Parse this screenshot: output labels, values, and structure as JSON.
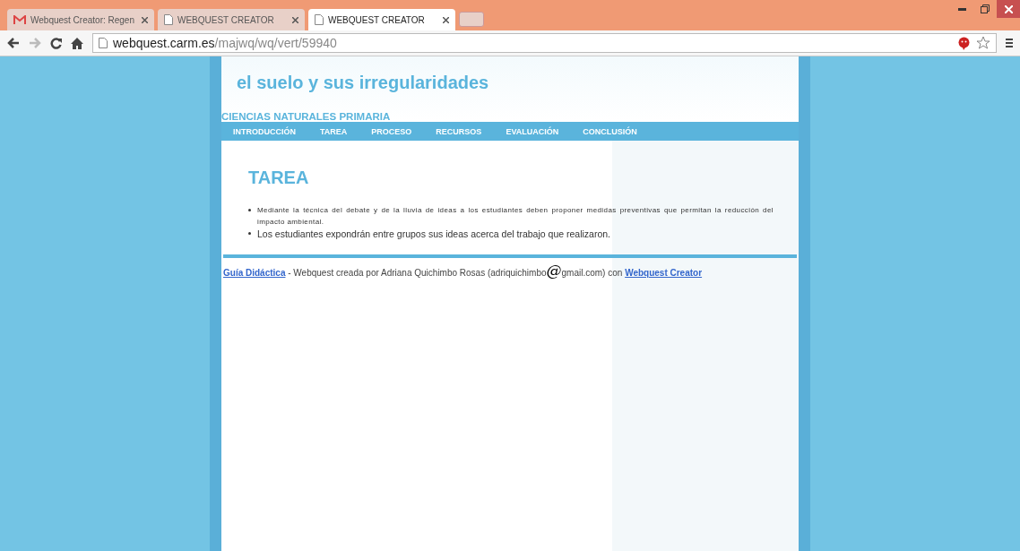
{
  "browser": {
    "tabs": [
      {
        "title": "Webquest Creator: Regen",
        "selected": false
      },
      {
        "title": "WEBQUEST CREATOR",
        "selected": false
      },
      {
        "title": "WEBQUEST CREATOR",
        "selected": true
      }
    ],
    "url_host": "webquest.carm.es",
    "url_path": "/majwq/wq/vert/59940"
  },
  "page": {
    "title": "el suelo y sus irregularidades",
    "subtitle": "CIENCIAS NATURALES PRIMARIA",
    "nav": [
      {
        "label": "INTRODUCCIÓN"
      },
      {
        "label": "TAREA"
      },
      {
        "label": "PROCESO"
      },
      {
        "label": "RECURSOS"
      },
      {
        "label": "EVALUACIÓN"
      },
      {
        "label": "CONCLUSIÓN"
      }
    ],
    "heading": "TAREA",
    "bullets": [
      {
        "text": "Mediante la técnica del debate y  de la  lluvia de ideas a los estudiantes deben proponer medidas preventivas que permitan la reducción del impacto ambiental.",
        "kind": "small"
      },
      {
        "text": "Los estudiantes expondrán entre grupos sus ideas acerca del trabajo que realizaron.",
        "kind": "normal"
      }
    ],
    "footer": [
      {
        "kind": "link",
        "text": "Guía Didáctica"
      },
      {
        "kind": "text",
        "text": " - Webquest creada por Adriana Quichimbo Rosas (adriquichimbo"
      },
      {
        "kind": "at",
        "text": "@"
      },
      {
        "kind": "text",
        "text": "gmail.com) con "
      },
      {
        "kind": "link",
        "text": "Webquest Creator"
      }
    ]
  }
}
